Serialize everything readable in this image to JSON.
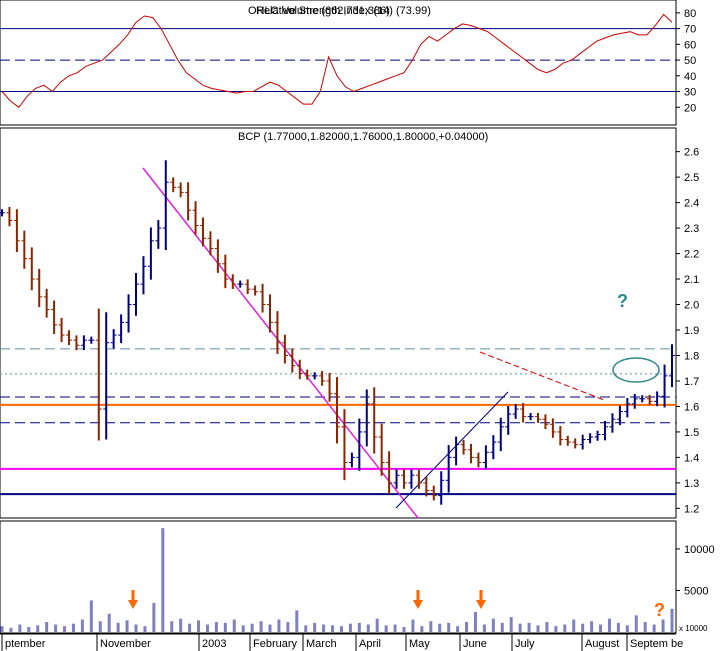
{
  "chart_data": [
    {
      "panel": "rsi",
      "type": "line",
      "title": "Relative Strength Index (14) (73.99)",
      "title_overlap_text": "OHLC Volume (662,731,386)",
      "ylim": [
        10,
        85
      ],
      "y_ticks": [
        "80",
        "70",
        "60",
        "50",
        "40",
        "30",
        "20"
      ],
      "reference_lines": [
        {
          "value": 70,
          "style": "solid",
          "color": "#000080"
        },
        {
          "value": 50,
          "style": "dashed",
          "color": "#000080"
        },
        {
          "value": 30,
          "style": "solid",
          "color": "#000080"
        }
      ],
      "series": [
        {
          "color": "#cc0000",
          "values": [
            30,
            24,
            20,
            27,
            32,
            34,
            30,
            36,
            40,
            42,
            46,
            48,
            50,
            55,
            60,
            66,
            74,
            78,
            77,
            70,
            60,
            50,
            42,
            38,
            34,
            32,
            31,
            30,
            29,
            30,
            30,
            33,
            36,
            34,
            30,
            26,
            22,
            22,
            30,
            52,
            40,
            33,
            30,
            32,
            34,
            36,
            38,
            40,
            42,
            50,
            60,
            65,
            62,
            66,
            70,
            73,
            72,
            70,
            68,
            64,
            60,
            56,
            52,
            48,
            44,
            42,
            44,
            48,
            50,
            54,
            58,
            62,
            64,
            66,
            67,
            68,
            66,
            66,
            72,
            79,
            74
          ]
        }
      ]
    },
    {
      "panel": "price",
      "type": "ohlc",
      "title": "BCP (1.77000,1.82000,1.76000,1.80000,+0.04000)",
      "ylim": [
        1.17,
        2.63
      ],
      "y_ticks": [
        "2.6",
        "2.5",
        "2.4",
        "2.3",
        "2.2",
        "2.1",
        "2.0",
        "1.9",
        "1.8",
        "1.7",
        "1.6",
        "1.5",
        "1.4",
        "1.3",
        "1.2"
      ],
      "close": [
        2.36,
        2.33,
        2.25,
        2.18,
        2.1,
        2.03,
        1.98,
        1.92,
        1.88,
        1.86,
        1.84,
        1.86,
        1.86,
        1.59,
        1.85,
        1.88,
        1.93,
        2.0,
        2.08,
        2.15,
        2.25,
        2.3,
        2.48,
        2.46,
        2.44,
        2.37,
        2.31,
        2.26,
        2.22,
        2.16,
        2.1,
        2.08,
        2.08,
        2.06,
        2.05,
        2.0,
        1.93,
        1.85,
        1.8,
        1.76,
        1.73,
        1.72,
        1.72,
        1.7,
        1.65,
        1.52,
        1.38,
        1.4,
        1.5,
        1.61,
        1.48,
        1.38,
        1.3,
        1.33,
        1.3,
        1.33,
        1.3,
        1.27,
        1.25,
        1.31,
        1.4,
        1.45,
        1.43,
        1.4,
        1.38,
        1.42,
        1.46,
        1.52,
        1.57,
        1.59,
        1.56,
        1.56,
        1.55,
        1.53,
        1.5,
        1.47,
        1.46,
        1.45,
        1.47,
        1.48,
        1.49,
        1.52,
        1.55,
        1.58,
        1.61,
        1.63,
        1.63,
        1.62,
        1.64,
        1.72,
        1.8
      ],
      "reference_lines": [
        {
          "value": 1.826,
          "style": "dashed",
          "color": "#5f8fa8"
        },
        {
          "value": 1.728,
          "style": "dotted",
          "color": "#5f8fa8"
        },
        {
          "value": 1.637,
          "style": "dashed",
          "color": "#000080"
        },
        {
          "value": 1.606,
          "style": "solid",
          "color": "#ff6600"
        },
        {
          "value": 1.536,
          "style": "dashed",
          "color": "#000080"
        },
        {
          "value": 1.355,
          "style": "solid",
          "color": "#ff00ff"
        },
        {
          "value": 1.256,
          "style": "solid",
          "color": "#000080"
        }
      ],
      "annotations": [
        {
          "text": "?",
          "color": "#2e8b8b",
          "near": "top-right"
        }
      ]
    },
    {
      "panel": "volume",
      "type": "bar",
      "ylim": [
        0,
        13000
      ],
      "y_ticks": [
        "10000",
        "5000"
      ],
      "scale_label": "x 10000",
      "bar_color": "#8080c0",
      "values": [
        700,
        500,
        900,
        600,
        800,
        1200,
        900,
        700,
        1000,
        1500,
        3800,
        1300,
        2200,
        1100,
        1400,
        900,
        700,
        3500,
        12500,
        1300,
        1600,
        1000,
        1400,
        900,
        1200,
        1100,
        1500,
        800,
        1000,
        1300,
        900,
        1500,
        1200,
        2600,
        800,
        1100,
        900,
        800,
        700,
        1000,
        1100,
        900,
        1600,
        800,
        900,
        600,
        1500,
        700,
        1300,
        1000,
        1100,
        700,
        1200,
        2400,
        900,
        1600,
        1100,
        1800,
        1000,
        1100,
        800,
        1200,
        700,
        900,
        1500,
        1000,
        1300,
        900,
        1600,
        1100,
        800,
        2000,
        1200,
        900,
        1500,
        2800
      ],
      "x_labels": [
        "ptember",
        "November",
        "2003",
        "February",
        "March",
        "April",
        "May",
        "June",
        "July",
        "August",
        "Septem be"
      ],
      "annotations": [
        {
          "text": "?",
          "color": "#ff6600",
          "near": "right"
        }
      ]
    }
  ]
}
